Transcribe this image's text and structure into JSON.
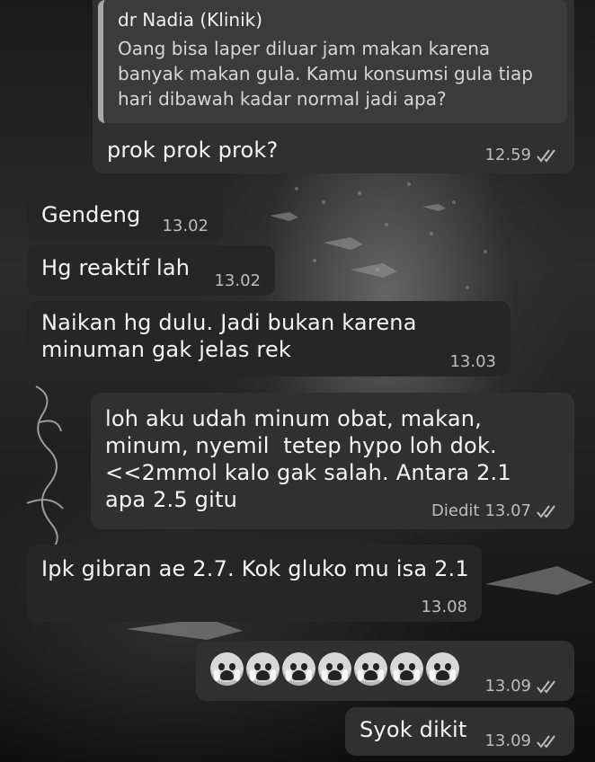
{
  "messages": [
    {
      "direction": "out",
      "reply_to": {
        "sender": "dr Nadia (Klinik)",
        "text": "Oang bisa laper diluar jam makan karena banyak makan gula. Kamu konsumsi gula tiap hari dibawah kadar normal jadi apa?"
      },
      "text": "prok prok prok?",
      "time": "12.59",
      "status_icon": "double-check-icon"
    },
    {
      "direction": "in",
      "text": "Gendeng",
      "time": "13.02"
    },
    {
      "direction": "in",
      "text": "Hg reaktif lah",
      "time": "13.02"
    },
    {
      "direction": "in",
      "text": "Naikan hg dulu. Jadi bukan karena minuman gak jelas rek",
      "time": "13.03"
    },
    {
      "direction": "out",
      "text": "loh aku udah minum obat, makan, minum, nyemil  tetep hypo loh dok. <<2mmol kalo gak salah. Antara 2.1 apa 2.5 gitu",
      "edited_label": "Diedit",
      "time": "13.07",
      "status_icon": "double-check-icon"
    },
    {
      "direction": "in",
      "text": "Ipk gibran ae 2.7. Kok gluko mu isa 2.1",
      "time": "13.08"
    },
    {
      "direction": "out",
      "emoji": [
        "crying-face-emoji",
        "crying-face-emoji",
        "crying-face-emoji",
        "crying-face-emoji",
        "crying-face-emoji",
        "crying-face-emoji",
        "crying-face-emoji"
      ],
      "time": "13.09",
      "status_icon": "double-check-icon"
    },
    {
      "direction": "out",
      "text": "Syok dikit",
      "time": "13.09",
      "status_icon": "double-check-icon"
    }
  ],
  "colors": {
    "incoming_bubble": "#262626",
    "outgoing_bubble": "#303030",
    "quote_background": "#3b3b3b",
    "text": "#f4f4f4",
    "meta_text": "#bdbdbd"
  }
}
